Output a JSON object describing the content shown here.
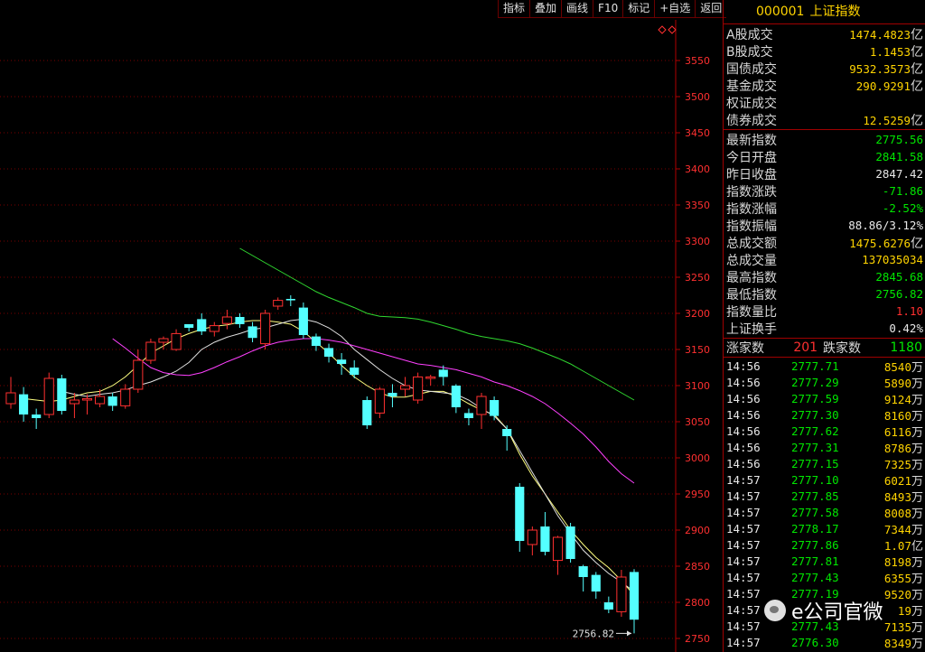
{
  "toolbar": [
    "指标",
    "叠加",
    "画线",
    "F10",
    "标记",
    "+自选",
    "返回"
  ],
  "header": {
    "code": "000001",
    "name": "上证指数"
  },
  "volumes": [
    {
      "k": "A股成交",
      "v": "1474.4823",
      "u": "亿",
      "c": "#ffd400"
    },
    {
      "k": "B股成交",
      "v": "1.1453",
      "u": "亿",
      "c": "#ffd400"
    },
    {
      "k": "国债成交",
      "v": "9532.3573",
      "u": "亿",
      "c": "#ffd400"
    },
    {
      "k": "基金成交",
      "v": "290.9291",
      "u": "亿",
      "c": "#ffd400"
    },
    {
      "k": "权证成交",
      "v": "",
      "u": "",
      "c": "#ffd400"
    },
    {
      "k": "债券成交",
      "v": "12.5259",
      "u": "亿",
      "c": "#ffd400"
    }
  ],
  "stats": [
    {
      "k": "最新指数",
      "v": "2775.56",
      "u": "",
      "c": "#00e600"
    },
    {
      "k": "今日开盘",
      "v": "2841.58",
      "u": "",
      "c": "#00e600"
    },
    {
      "k": "昨日收盘",
      "v": "2847.42",
      "u": "",
      "c": "#e8e8e8"
    },
    {
      "k": "指数涨跌",
      "v": "-71.86",
      "u": "",
      "c": "#00e600"
    },
    {
      "k": "指数涨幅",
      "v": "-2.52%",
      "u": "",
      "c": "#00e600"
    },
    {
      "k": "指数振幅",
      "v": "88.86/3.12%",
      "u": "",
      "c": "#e8e8e8"
    },
    {
      "k": "总成交额",
      "v": "1475.6276",
      "u": "亿",
      "c": "#ffd400"
    },
    {
      "k": "总成交量",
      "v": "137035034",
      "u": "",
      "c": "#ffd400"
    },
    {
      "k": "最高指数",
      "v": "2845.68",
      "u": "",
      "c": "#00e600"
    },
    {
      "k": "最低指数",
      "v": "2756.82",
      "u": "",
      "c": "#00e600"
    },
    {
      "k": "指数量比",
      "v": "1.10",
      "u": "",
      "c": "#ff3030"
    },
    {
      "k": "上证换手",
      "v": "0.42%",
      "u": "",
      "c": "#e8e8e8"
    }
  ],
  "advance": {
    "up_label": "涨家数",
    "up": "201",
    "down_label": "跌家数",
    "down": "1180"
  },
  "ticks": [
    {
      "t": "14:56",
      "p": "2777.71",
      "v": "8540",
      "u": "万"
    },
    {
      "t": "14:56",
      "p": "2777.29",
      "v": "5890",
      "u": "万"
    },
    {
      "t": "14:56",
      "p": "2777.59",
      "v": "9124",
      "u": "万"
    },
    {
      "t": "14:56",
      "p": "2777.30",
      "v": "8160",
      "u": "万"
    },
    {
      "t": "14:56",
      "p": "2777.62",
      "v": "6116",
      "u": "万"
    },
    {
      "t": "14:56",
      "p": "2777.31",
      "v": "8786",
      "u": "万"
    },
    {
      "t": "14:56",
      "p": "2777.15",
      "v": "7325",
      "u": "万"
    },
    {
      "t": "14:57",
      "p": "2777.10",
      "v": "6021",
      "u": "万"
    },
    {
      "t": "14:57",
      "p": "2777.85",
      "v": "8493",
      "u": "万"
    },
    {
      "t": "14:57",
      "p": "2777.58",
      "v": "8008",
      "u": "万"
    },
    {
      "t": "14:57",
      "p": "2778.17",
      "v": "7344",
      "u": "万"
    },
    {
      "t": "14:57",
      "p": "2777.86",
      "v": "1.07",
      "u": "亿"
    },
    {
      "t": "14:57",
      "p": "2777.81",
      "v": "8198",
      "u": "万"
    },
    {
      "t": "14:57",
      "p": "2777.43",
      "v": "6355",
      "u": "万"
    },
    {
      "t": "14:57",
      "p": "2777.19",
      "v": "9520",
      "u": "万"
    },
    {
      "t": "14:57",
      "p": "",
      "v": "19",
      "u": "万"
    },
    {
      "t": "14:57",
      "p": "2777.43",
      "v": "7135",
      "u": "万"
    },
    {
      "t": "14:57",
      "p": "2776.30",
      "v": "8349",
      "u": "万"
    }
  ],
  "watermark": "e公司官微",
  "chart_data": {
    "type": "candlestick",
    "y_ticks": [
      3550,
      3500,
      3450,
      3400,
      3350,
      3300,
      3250,
      3200,
      3150,
      3100,
      3050,
      3000,
      2950,
      2900,
      2850,
      2800,
      2750
    ],
    "ylim": [
      2735,
      3600
    ],
    "low_label": "2756.82",
    "up_color": "#ff3030",
    "down_color": "#54ffff",
    "candles": [
      [
        3075,
        3090,
        3112,
        3068
      ],
      [
        3088,
        3060,
        3098,
        3050
      ],
      [
        3060,
        3055,
        3068,
        3040
      ],
      [
        3060,
        3110,
        3118,
        3055
      ],
      [
        3110,
        3065,
        3115,
        3060
      ],
      [
        3075,
        3080,
        3090,
        3055
      ],
      [
        3080,
        3082,
        3088,
        3060
      ],
      [
        3075,
        3085,
        3095,
        3070
      ],
      [
        3085,
        3072,
        3090,
        3065
      ],
      [
        3072,
        3095,
        3102,
        3068
      ],
      [
        3095,
        3135,
        3150,
        3090
      ],
      [
        3135,
        3160,
        3165,
        3130
      ],
      [
        3160,
        3165,
        3168,
        3150
      ],
      [
        3150,
        3172,
        3178,
        3148
      ],
      [
        3185,
        3180,
        3185,
        3175
      ],
      [
        3192,
        3175,
        3200,
        3170
      ],
      [
        3175,
        3183,
        3188,
        3168
      ],
      [
        3186,
        3195,
        3205,
        3178
      ],
      [
        3195,
        3185,
        3200,
        3180
      ],
      [
        3182,
        3166,
        3188,
        3160
      ],
      [
        3158,
        3200,
        3205,
        3150
      ],
      [
        3210,
        3218,
        3222,
        3205
      ],
      [
        3220,
        3218,
        3225,
        3210
      ],
      [
        3208,
        3170,
        3215,
        3165
      ],
      [
        3168,
        3155,
        3172,
        3148
      ],
      [
        3152,
        3140,
        3158,
        3132
      ],
      [
        3136,
        3130,
        3145,
        3115
      ],
      [
        3125,
        3115,
        3135,
        3110
      ],
      [
        3080,
        3045,
        3085,
        3040
      ],
      [
        3062,
        3095,
        3098,
        3055
      ],
      [
        3090,
        3085,
        3102,
        3070
      ],
      [
        3095,
        3100,
        3112,
        3085
      ],
      [
        3080,
        3112,
        3118,
        3075
      ],
      [
        3110,
        3112,
        3115,
        3100
      ],
      [
        3122,
        3112,
        3128,
        3100
      ],
      [
        3100,
        3070,
        3102,
        3062
      ],
      [
        3062,
        3055,
        3068,
        3045
      ],
      [
        3060,
        3085,
        3090,
        3040
      ],
      [
        3080,
        3058,
        3085,
        3052
      ],
      [
        3040,
        3030,
        3045,
        3010
      ],
      [
        2960,
        2885,
        2965,
        2870
      ],
      [
        2880,
        2900,
        2905,
        2865
      ],
      [
        2905,
        2870,
        2925,
        2865
      ],
      [
        2858,
        2890,
        2892,
        2838
      ],
      [
        2905,
        2860,
        2910,
        2855
      ],
      [
        2850,
        2835,
        2852,
        2815
      ],
      [
        2838,
        2815,
        2842,
        2805
      ],
      [
        2800,
        2790,
        2808,
        2785
      ],
      [
        2787,
        2835,
        2845,
        2780
      ],
      [
        2842,
        2776,
        2846,
        2757
      ]
    ],
    "series": [
      {
        "color": "#ffff80",
        "values": [
          3082,
          3080,
          3078,
          3080,
          3085,
          3090,
          3092,
          3100,
          3112,
          3128,
          3145,
          3155,
          3165,
          3172,
          3178,
          3182,
          3184,
          3188,
          3190,
          3190,
          3188,
          3185,
          3175,
          3160,
          3145,
          3128,
          3112,
          3100,
          3090,
          3084,
          3084,
          3088,
          3092,
          3092,
          3085,
          3075,
          3066,
          3060,
          3040,
          3005,
          2975,
          2950,
          2925,
          2900,
          2880,
          2862,
          2848,
          2830,
          2810
        ]
      },
      {
        "color": "#e0e0e0",
        "values": [
          3092,
          3088,
          3085,
          3088,
          3090,
          3094,
          3100,
          3105,
          3112,
          3120,
          3132,
          3150,
          3160,
          3167,
          3172,
          3178,
          3180,
          3185,
          3190,
          3192,
          3188,
          3180,
          3168,
          3150,
          3136,
          3122,
          3110,
          3100,
          3094,
          3092,
          3090,
          3088,
          3080,
          3068,
          3058,
          3040,
          3010,
          2980,
          2950,
          2920,
          2895,
          2872,
          2855,
          2840,
          2828,
          2815
        ]
      },
      {
        "color": "#ff40ff",
        "values": [
          3165,
          3152,
          3138,
          3125,
          3118,
          3115,
          3114,
          3118,
          3125,
          3133,
          3140,
          3148,
          3155,
          3160,
          3163,
          3165,
          3165,
          3163,
          3160,
          3155,
          3150,
          3145,
          3140,
          3135,
          3130,
          3128,
          3125,
          3122,
          3117,
          3112,
          3105,
          3100,
          3093,
          3085,
          3075,
          3062,
          3048,
          3033,
          3015,
          2995,
          2978,
          2965
        ]
      },
      {
        "color": "#30d830",
        "values": [
          3290,
          3280,
          3270,
          3260,
          3250,
          3240,
          3230,
          3222,
          3215,
          3208,
          3200,
          3196,
          3195,
          3194,
          3192,
          3188,
          3183,
          3178,
          3172,
          3168,
          3165,
          3162,
          3158,
          3152,
          3145,
          3138,
          3130,
          3120,
          3110,
          3100,
          3090,
          3080
        ]
      }
    ]
  }
}
